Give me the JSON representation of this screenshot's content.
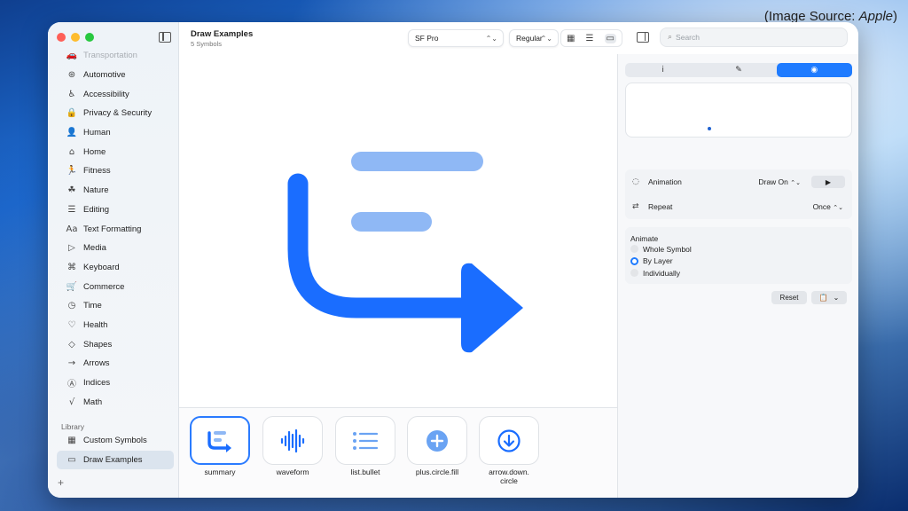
{
  "source_note": "(Image Source: Apple)",
  "source_note_prefix": "(Image Source: ",
  "source_note_name": "Apple",
  "source_note_suffix": ")",
  "colors": {
    "accent": "#1e7bff",
    "symbol_main": "#1a6dff",
    "symbol_light": "#8fb8f5"
  },
  "sidebar": {
    "items": [
      {
        "label": "Transportation",
        "icon": "car-icon",
        "glyph": "🚗"
      },
      {
        "label": "Automotive",
        "icon": "steering-wheel-icon",
        "glyph": "⊛"
      },
      {
        "label": "Accessibility",
        "icon": "accessibility-icon",
        "glyph": "♿"
      },
      {
        "label": "Privacy & Security",
        "icon": "lock-icon",
        "glyph": "🔒"
      },
      {
        "label": "Human",
        "icon": "person-icon",
        "glyph": "👤"
      },
      {
        "label": "Home",
        "icon": "house-icon",
        "glyph": "⌂"
      },
      {
        "label": "Fitness",
        "icon": "running-figure-icon",
        "glyph": "🏃"
      },
      {
        "label": "Nature",
        "icon": "leaf-icon",
        "glyph": "☘"
      },
      {
        "label": "Editing",
        "icon": "sliders-icon",
        "glyph": "☰"
      },
      {
        "label": "Text Formatting",
        "icon": "text-format-icon",
        "glyph": "Aa"
      },
      {
        "label": "Media",
        "icon": "play-pause-icon",
        "glyph": "▷"
      },
      {
        "label": "Keyboard",
        "icon": "command-key-icon",
        "glyph": "⌘"
      },
      {
        "label": "Commerce",
        "icon": "cart-icon",
        "glyph": "🛒"
      },
      {
        "label": "Time",
        "icon": "clock-icon",
        "glyph": "◷"
      },
      {
        "label": "Health",
        "icon": "heart-icon",
        "glyph": "♡"
      },
      {
        "label": "Shapes",
        "icon": "shapes-icon",
        "glyph": "◇"
      },
      {
        "label": "Arrows",
        "icon": "arrow-right-icon",
        "glyph": "→"
      },
      {
        "label": "Indices",
        "icon": "circled-a-icon",
        "glyph": "Ⓐ"
      },
      {
        "label": "Math",
        "icon": "square-root-icon",
        "glyph": "√"
      }
    ],
    "library_title": "Library",
    "library_items": [
      {
        "label": "Custom Symbols",
        "icon": "grid-icon",
        "glyph": "▦"
      },
      {
        "label": "Draw Examples",
        "icon": "folder-icon",
        "glyph": "▭"
      }
    ],
    "add_glyph": "+"
  },
  "header": {
    "title": "Draw Examples",
    "subtitle": "5 Symbols",
    "font_select": "SF Pro",
    "weight_select": "Regular",
    "chevron": "⌃⌄",
    "view_glyphs": [
      "▦",
      "☰",
      "▭"
    ]
  },
  "search": {
    "placeholder": "Search",
    "glyph": "⌕"
  },
  "gallery": {
    "tiles": [
      {
        "label": "summary",
        "icon": "summary-icon"
      },
      {
        "label": "waveform",
        "icon": "waveform-icon"
      },
      {
        "label": "list.bullet",
        "icon": "list-bullet-icon"
      },
      {
        "label": "plus.circle.fill",
        "icon": "plus-circle-fill-icon"
      },
      {
        "label": "arrow.down.\ncircle",
        "icon": "arrow-down-circle-icon"
      }
    ]
  },
  "inspector": {
    "tabs": [
      {
        "glyph": "i",
        "icon": "info-icon"
      },
      {
        "glyph": "✎",
        "icon": "paintbrush-icon"
      },
      {
        "glyph": "◉",
        "icon": "animation-icon"
      }
    ],
    "animation_label": "Animation",
    "animation_value": "Draw On",
    "animation_glyph": "◌",
    "play_glyph": "▶",
    "repeat_label": "Repeat",
    "repeat_value": "Once",
    "repeat_glyph": "⇄",
    "stepper_glyph": "⌃⌄",
    "animate_title": "Animate",
    "animate_options": [
      {
        "label": "Whole Symbol",
        "selected": false
      },
      {
        "label": "By Layer",
        "selected": true
      },
      {
        "label": "Individually",
        "selected": false
      }
    ],
    "reset_label": "Reset",
    "copy_glyph": "📋",
    "menu_glyph": "⌄"
  }
}
